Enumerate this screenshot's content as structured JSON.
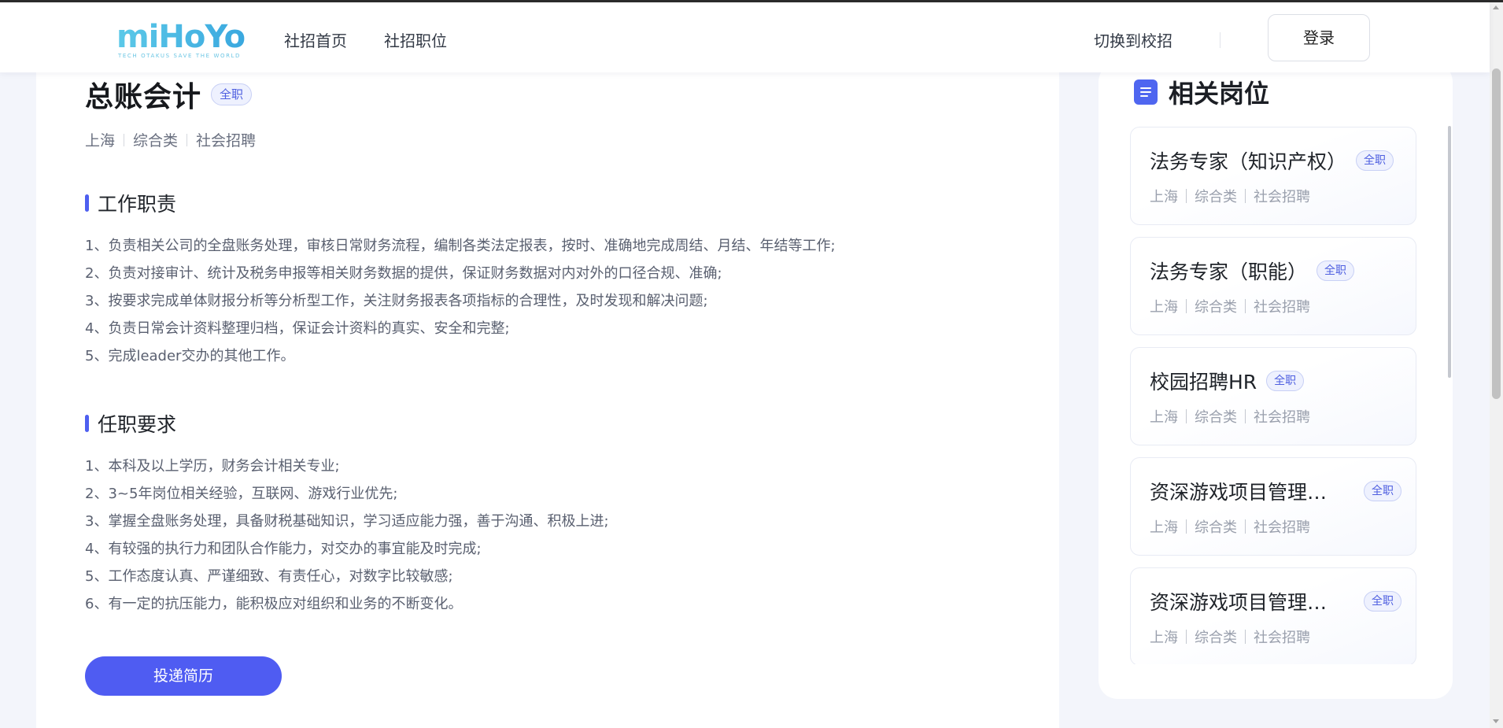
{
  "header": {
    "logo_text": "miHoYo",
    "logo_tagline": "TECH OTAKUS SAVE THE WORLD",
    "nav": [
      "社招首页",
      "社招职位"
    ],
    "switch_label": "切换到校招",
    "login_label": "登录"
  },
  "job": {
    "title": "总账会计",
    "type_badge": "全职",
    "meta": [
      "上海",
      "综合类",
      "社会招聘"
    ],
    "responsibilities_title": "工作职责",
    "responsibilities": [
      "1、负责相关公司的全盘账务处理，审核日常财务流程，编制各类法定报表，按时、准确地完成周结、月结、年结等工作;",
      "2、负责对接审计、统计及税务申报等相关财务数据的提供，保证财务数据对内对外的口径合规、准确;",
      "3、按要求完成单体财报分析等分析型工作，关注财务报表各项指标的合理性，及时发现和解决问题;",
      "4、负责日常会计资料整理归档，保证会计资料的真实、安全和完整;",
      "5、完成leader交办的其他工作。"
    ],
    "requirements_title": "任职要求",
    "requirements": [
      "1、本科及以上学历，财务会计相关专业;",
      "2、3~5年岗位相关经验，互联网、游戏行业优先;",
      "3、掌握全盘账务处理，具备财税基础知识，学习适应能力强，善于沟通、积极上进;",
      "4、有较强的执行力和团队合作能力，对交办的事宜能及时完成;",
      "5、工作态度认真、严谨细致、有责任心，对数字比较敏感;",
      "6、有一定的抗压能力，能积极应对组织和业务的不断变化。"
    ],
    "apply_label": "投递简历"
  },
  "related": {
    "title": "相关岗位",
    "items": [
      {
        "title": "法务专家（知识产权）",
        "badge": "全职",
        "meta": [
          "上海",
          "综合类",
          "社会招聘"
        ]
      },
      {
        "title": "法务专家（职能）",
        "badge": "全职",
        "meta": [
          "上海",
          "综合类",
          "社会招聘"
        ]
      },
      {
        "title": "校园招聘HR",
        "badge": "全职",
        "meta": [
          "上海",
          "综合类",
          "社会招聘"
        ]
      },
      {
        "title": "资深游戏项目管理-...",
        "badge": "全职",
        "meta": [
          "上海",
          "综合类",
          "社会招聘"
        ]
      },
      {
        "title": "资深游戏项目管理-...",
        "badge": "全职",
        "meta": [
          "上海",
          "综合类",
          "社会招聘"
        ]
      }
    ]
  },
  "colors": {
    "accent": "#4f5cf2",
    "page_bg": "#f3f5fb",
    "badge_bg": "#eef1fe"
  }
}
